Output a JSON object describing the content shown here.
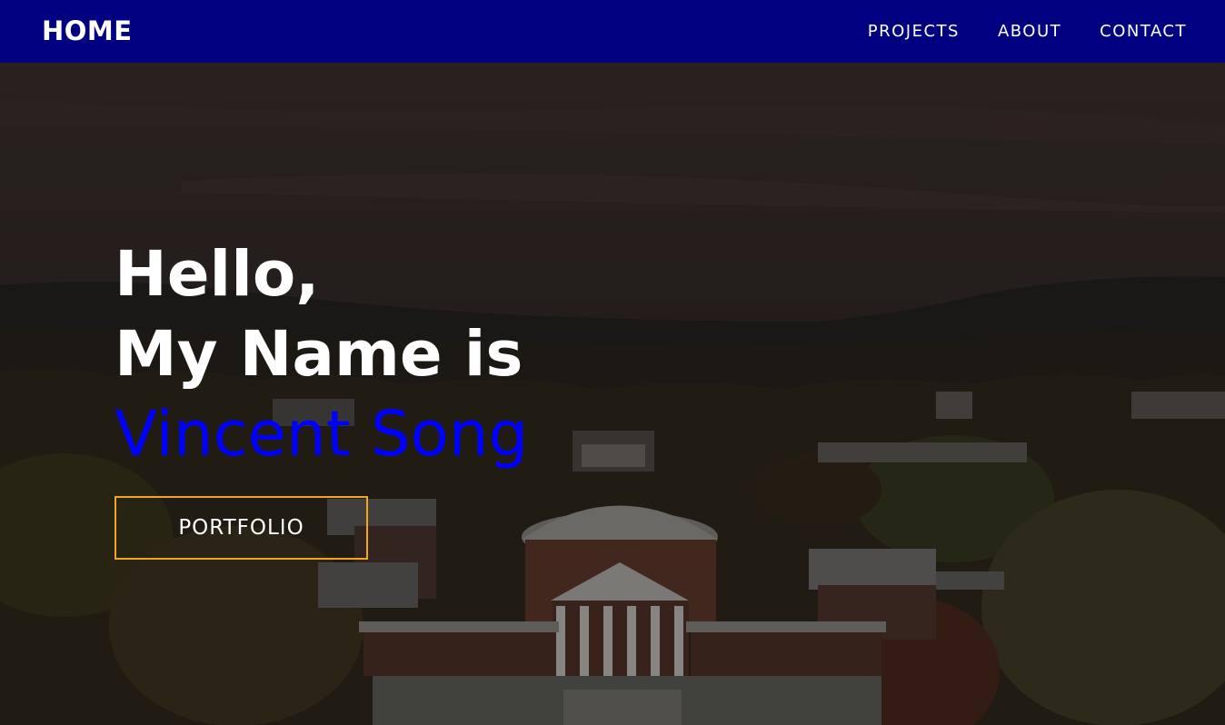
{
  "nav": {
    "brand": "HOME",
    "links": [
      "PROJECTS",
      "ABOUT",
      "CONTACT"
    ]
  },
  "hero": {
    "line1": "Hello,",
    "line2": "My Name is",
    "name": "Vincent Song",
    "button_label": "PORTFOLIO"
  },
  "colors": {
    "navbar_bg": "#000080",
    "name_color": "#0000ff",
    "button_border": "#f3a51c"
  }
}
